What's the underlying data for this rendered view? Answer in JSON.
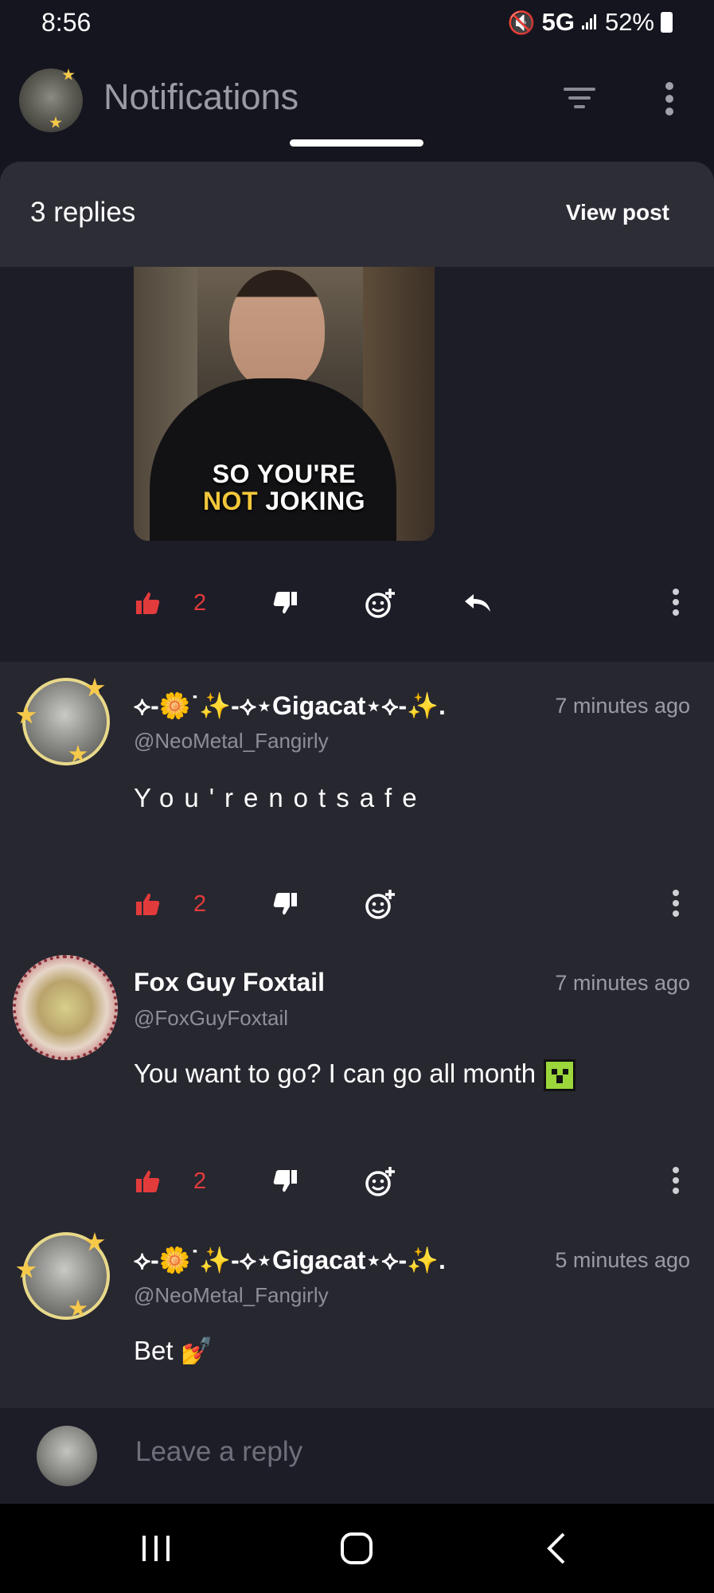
{
  "status_bar": {
    "time": "8:56",
    "network": "5G",
    "battery": "52%",
    "icons": [
      "mute-icon",
      "signal-icon",
      "battery-icon"
    ]
  },
  "header": {
    "title": "Notifications",
    "icons": [
      "filter-icon",
      "more-vert-icon"
    ]
  },
  "sheet": {
    "replies_label": "3 replies",
    "view_post_label": "View post"
  },
  "parent_post": {
    "gif_caption_line1": "SO YOU'RE",
    "gif_caption_highlight": "NOT",
    "gif_caption_line2_rest": "JOKING",
    "like_count": "2"
  },
  "comments": [
    {
      "name": "⟡-🌼˙✨-⟡⋆Gigacat⋆⟡-✨.",
      "time": "7 minutes ago",
      "handle": "@NeoMetal_Fangirly",
      "text": "You'renotsafe",
      "like_count": "2"
    },
    {
      "name": "Fox Guy Foxtail",
      "time": "7 minutes ago",
      "handle": "@FoxGuyFoxtail",
      "text": "You want to go? I can go all month",
      "like_count": "2"
    },
    {
      "name": "⟡-🌼˙✨-⟡⋆Gigacat⋆⟡-✨.",
      "time": "5 minutes ago",
      "handle": "@NeoMetal_Fangirly",
      "text": "Bet 💅"
    }
  ],
  "reply_bar": {
    "placeholder": "Leave a reply"
  },
  "colors": {
    "background": "#15151f",
    "sheet": "#272730",
    "like_active": "#e23b3b",
    "muted_text": "#9b9ba6"
  }
}
